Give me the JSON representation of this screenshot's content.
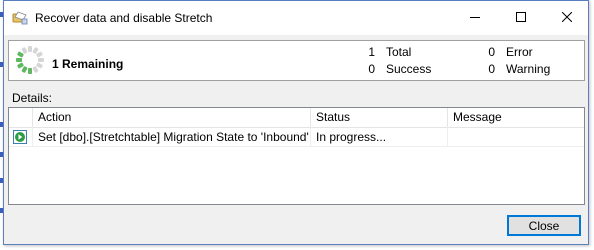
{
  "dialog": {
    "title": "Recover data and disable Stretch"
  },
  "summary": {
    "remaining_label": "1  Remaining",
    "stats": [
      {
        "value": "1",
        "label": "Total"
      },
      {
        "value": "0",
        "label": "Success"
      },
      {
        "value": "0",
        "label": "Error"
      },
      {
        "value": "0",
        "label": "Warning"
      }
    ]
  },
  "details": {
    "label": "Details:",
    "columns": [
      "Action",
      "Status",
      "Message"
    ],
    "rows": [
      {
        "action": "Set [dbo].[Stretchtable] Migration State to 'Inbound'",
        "status": "In progress...",
        "message": ""
      }
    ]
  },
  "footer": {
    "close_label": "Close"
  },
  "colors": {
    "accent": "#0078d7",
    "spinner_active": "#5fb85f"
  }
}
